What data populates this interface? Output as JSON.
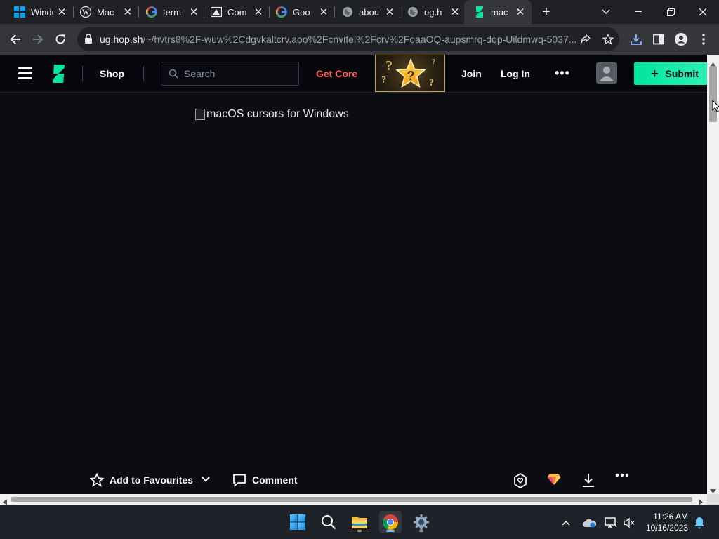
{
  "browser": {
    "tabs": [
      {
        "title": "Windo",
        "icon": "windows-icon"
      },
      {
        "title": "Mac",
        "icon": "wordpress-icon"
      },
      {
        "title": "term",
        "icon": "google-icon"
      },
      {
        "title": "Com",
        "icon": "zoom-icon"
      },
      {
        "title": "Goo",
        "icon": "google-icon"
      },
      {
        "title": "abou",
        "icon": "globe-icon"
      },
      {
        "title": "ug.h",
        "icon": "globe-icon"
      },
      {
        "title": "mac",
        "icon": "deviantart-icon",
        "active": true
      }
    ],
    "url_host": "ug.hop.sh",
    "url_path": "/~/hvtrs8%2F-wuw%2Cdgvkaltcrv.aoo%2Fcnvifel%2Fcrv%2FoaaOQ-aupsmrq-dop-Uildmwq-5037..."
  },
  "site": {
    "nav": {
      "shop": "Shop",
      "search_placeholder": "Search",
      "get_core": "Get Core",
      "join": "Join",
      "login": "Log In",
      "more": "•••",
      "submit": "Submit"
    },
    "image_alt": "macOS cursors for Windows",
    "actions": {
      "favourite": "Add to Favourites",
      "comment": "Comment"
    }
  },
  "taskbar": {
    "time": "11:26 AM",
    "date": "10/16/2023"
  },
  "colors": {
    "accent_green": "#00e59b",
    "core_red": "#ff5f52",
    "page_bg": "#0b0d12"
  }
}
